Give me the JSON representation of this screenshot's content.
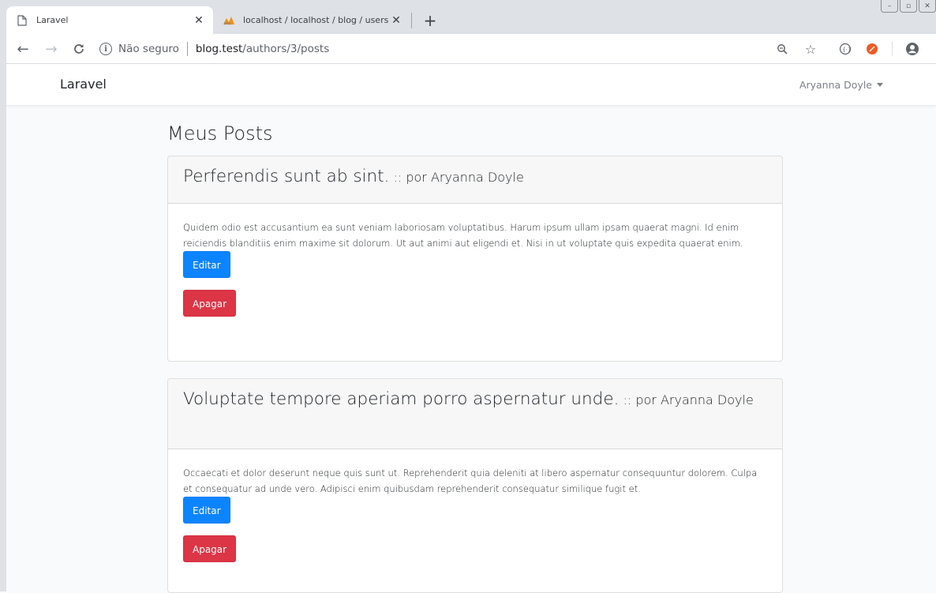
{
  "browser": {
    "tabs": [
      {
        "title": "Laravel",
        "active": true
      },
      {
        "title": "localhost / localhost / blog / users",
        "active": false
      }
    ],
    "address": {
      "security_label": "Não seguro",
      "host": "blog.test",
      "path": "/authors/3/posts"
    }
  },
  "navbar": {
    "brand": "Laravel",
    "user_name": "Aryanna Doyle"
  },
  "page": {
    "title": "Meus Posts"
  },
  "posts": [
    {
      "title": "Perferendis sunt ab sint.",
      "by": ":: por Aryanna Doyle",
      "body": "Quidem odio est accusantium ea sunt veniam laboriosam voluptatibus. Harum ipsum ullam ipsam quaerat magni. Id enim reiciendis blanditiis enim maxime sit dolorum. Ut aut animi aut eligendi et. Nisi in ut voluptate quis expedita quaerat enim.",
      "edit_label": "Editar",
      "delete_label": "Apagar"
    },
    {
      "title": "Voluptate tempore aperiam porro aspernatur unde.",
      "by": ":: por Aryanna Doyle",
      "body": "Occaecati et dolor deserunt neque quis sunt ut. Reprehenderit quia deleniti at libero aspernatur consequuntur dolorem. Culpa et consequatur ad unde vero. Adipisci enim quibusdam reprehenderit consequatur similique fugit et.",
      "edit_label": "Editar",
      "delete_label": "Apagar"
    }
  ],
  "colors": {
    "primary": "#0d84ff",
    "danger": "#dc3545",
    "page_bg": "#f8fafc"
  }
}
